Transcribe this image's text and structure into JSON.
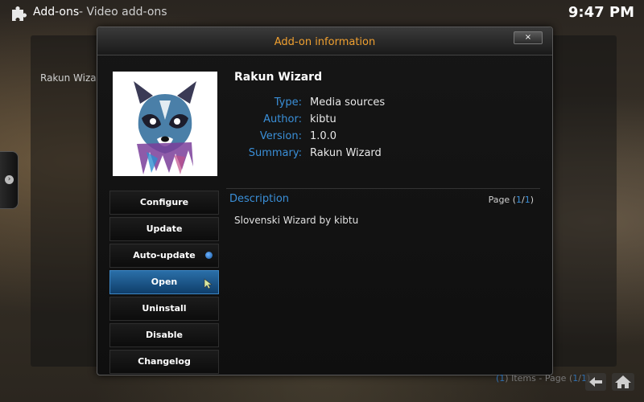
{
  "topbar": {
    "section": "Add-ons",
    "subsection": "- Video add-ons",
    "clock": "9:47 PM"
  },
  "background": {
    "list_item": "Rakun Wizar"
  },
  "dialog": {
    "title": "Add-on information",
    "close_label": "×",
    "addon_name": "Rakun Wizard",
    "info": [
      {
        "label": "Type:",
        "value": "Media sources"
      },
      {
        "label": "Author:",
        "value": "kibtu"
      },
      {
        "label": "Version:",
        "value": "1.0.0"
      },
      {
        "label": "Summary:",
        "value": "Rakun Wizard"
      }
    ],
    "buttons": [
      {
        "label": "Configure"
      },
      {
        "label": "Update"
      },
      {
        "label": "Auto-update"
      },
      {
        "label": "Open"
      },
      {
        "label": "Uninstall"
      },
      {
        "label": "Disable"
      },
      {
        "label": "Changelog"
      }
    ],
    "description": {
      "title": "Description",
      "page_prefix": "Page (",
      "page_current": "1",
      "page_sep": "/",
      "page_total": "1",
      "page_suffix": ")",
      "text": "Slovenski Wizard by kibtu"
    }
  },
  "footer": {
    "items_open": "(",
    "items_count": "1",
    "items_text": ") Items - Page (",
    "page_current": "1",
    "page_sep": "/",
    "page_total": "1",
    "page_close": ")"
  },
  "icons": {
    "addons": "puzzle-icon",
    "close": "close-icon",
    "back": "back-arrow-icon",
    "home": "home-icon",
    "side": "chevron-right-icon",
    "pointer": "mouse-pointer-icon"
  },
  "colors": {
    "title_accent": "#f0a030",
    "label_blue": "#3a8fd8",
    "focus_blue": "#2a6fa8"
  }
}
